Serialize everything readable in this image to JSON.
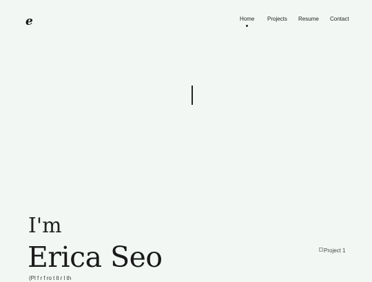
{
  "header": {
    "logo_text": "e"
  },
  "nav": {
    "items": [
      {
        "label": "Home",
        "active": true
      },
      {
        "label": "Projects"
      },
      {
        "label": "Resume"
      },
      {
        "label": "Contact"
      }
    ]
  },
  "hero": {
    "typed_text": "I",
    "intro": "I'm",
    "name": "Erica Seo",
    "subtitle": "(Pl f r  f ro t  lt  r  l  th"
  },
  "projects": {
    "first_image_alt": "Project 1"
  },
  "colors": {
    "background": "#f2f7f4",
    "text": "#1c1c1c"
  }
}
